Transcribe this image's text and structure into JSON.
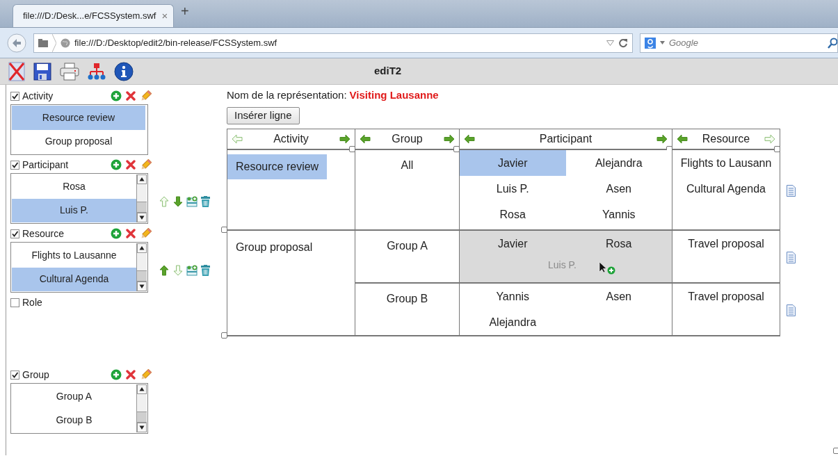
{
  "browser": {
    "tab": {
      "title": "file:///D:/Desk...e/FCSSystem.swf",
      "close": "×"
    },
    "new_tab": "+",
    "url": "file:///D:/Desktop/edit2/bin-release/FCSSystem.swf",
    "search": {
      "placeholder": "Google"
    }
  },
  "app": {
    "title": "ediT2"
  },
  "sidebar": {
    "panels": [
      {
        "label": "Activity",
        "checked": true,
        "scrollbar": false,
        "items": [
          {
            "label": "Resource review",
            "selected": true
          },
          {
            "label": "Group proposal",
            "selected": false
          }
        ]
      },
      {
        "label": "Participant",
        "checked": true,
        "scrollbar": true,
        "items": [
          {
            "label": "Rosa",
            "selected": false
          },
          {
            "label": "Luis P.",
            "selected": true
          }
        ],
        "reorder": {
          "up_enabled": false,
          "down_enabled": true
        }
      },
      {
        "label": "Resource",
        "checked": true,
        "scrollbar": true,
        "items": [
          {
            "label": "Flights to Lausanne",
            "selected": false
          },
          {
            "label": "Cultural Agenda",
            "selected": true
          }
        ],
        "reorder": {
          "up_enabled": true,
          "down_enabled": false
        }
      },
      {
        "label": "Role",
        "checked": false
      },
      {
        "label": "Group",
        "checked": true,
        "scrollbar": true,
        "items": [
          {
            "label": "Group A",
            "selected": false
          },
          {
            "label": "Group B",
            "selected": false
          }
        ]
      }
    ]
  },
  "representation": {
    "label": "Nom de la représentation:",
    "name": "Visiting Lausanne"
  },
  "insert_button": "Insérer ligne",
  "table": {
    "columns": [
      {
        "label": "Activity",
        "left_enabled": false,
        "right_enabled": true
      },
      {
        "label": "Group",
        "left_enabled": true,
        "right_enabled": true
      },
      {
        "label": "Participant",
        "left_enabled": true,
        "right_enabled": true
      },
      {
        "label": "Resource",
        "left_enabled": true,
        "right_enabled": false
      }
    ],
    "rows": [
      {
        "activity": {
          "label": "Resource review",
          "selected": true
        },
        "groups": [
          {
            "group": "All",
            "drop_target": false,
            "participants": [
              {
                "name": "Javier",
                "selected": true
              },
              {
                "name": "Alejandra",
                "selected": false
              },
              {
                "name": "Luis P.",
                "selected": false
              },
              {
                "name": "Asen",
                "selected": false
              },
              {
                "name": "Rosa",
                "selected": false
              },
              {
                "name": "Yannis",
                "selected": false
              }
            ],
            "resources": [
              "Flights to Lausann",
              "Cultural Agenda"
            ]
          }
        ]
      },
      {
        "activity": {
          "label": "Group proposal",
          "selected": false
        },
        "groups": [
          {
            "group": "Group A",
            "drop_target": true,
            "dragged": "Luis P.",
            "participants": [
              {
                "name": "Javier",
                "selected": false
              },
              {
                "name": "Rosa",
                "selected": false
              }
            ],
            "resources": [
              "Travel proposal"
            ]
          },
          {
            "group": "Group B",
            "drop_target": false,
            "participants": [
              {
                "name": "Yannis",
                "selected": false
              },
              {
                "name": "Asen",
                "selected": false
              },
              {
                "name": "Alejandra",
                "selected": false
              }
            ],
            "resources": [
              "Travel proposal"
            ]
          }
        ]
      }
    ]
  }
}
